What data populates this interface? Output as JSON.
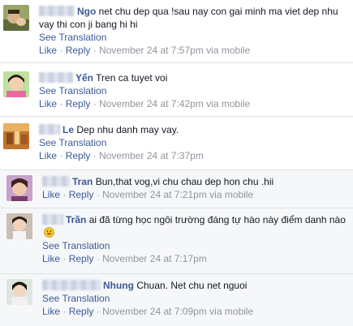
{
  "comments": [
    {
      "name": "Ngo",
      "text": "net chu dep qua !sau nay con gai minh ma viet dep nhu vay thi con ji bang hi hi",
      "see_translation": "See Translation",
      "like": "Like",
      "reply": "Reply",
      "time": "November 24 at 7:57pm",
      "via": "via mobile"
    },
    {
      "name": "Yến",
      "text": "Tren ca tuyet voi",
      "see_translation": "See Translation",
      "like": "Like",
      "reply": "Reply",
      "time": "November 24 at 7:42pm",
      "via": "via mobile"
    },
    {
      "name": "Le",
      "text": "Dep nhu danh may vay.",
      "see_translation": "See Translation",
      "like": "Like",
      "reply": "Reply",
      "time": "November 24 at 7:37pm",
      "via": ""
    },
    {
      "name": "Tran",
      "text": "Bun,that vog,vi chu chau dep hon chu .hii",
      "like": "Like",
      "reply": "Reply",
      "time": "November 24 at 7:21pm",
      "via": "via mobile"
    },
    {
      "name": "Trần",
      "text": "ai đã từng học ngôi trường đáng tự hào này điểm danh nào",
      "emoji": "grin-emoticon",
      "see_translation": "See Translation",
      "like": "Like",
      "reply": "Reply",
      "time": "November 24 at 7:17pm",
      "via": ""
    },
    {
      "name": "Nhung",
      "text": "Chuan. Net chu net nguoi",
      "see_translation": "See Translation",
      "like": "Like",
      "reply": "Reply",
      "time": "November 24 at 7:09pm",
      "via": "via mobile"
    }
  ],
  "separator": "·"
}
